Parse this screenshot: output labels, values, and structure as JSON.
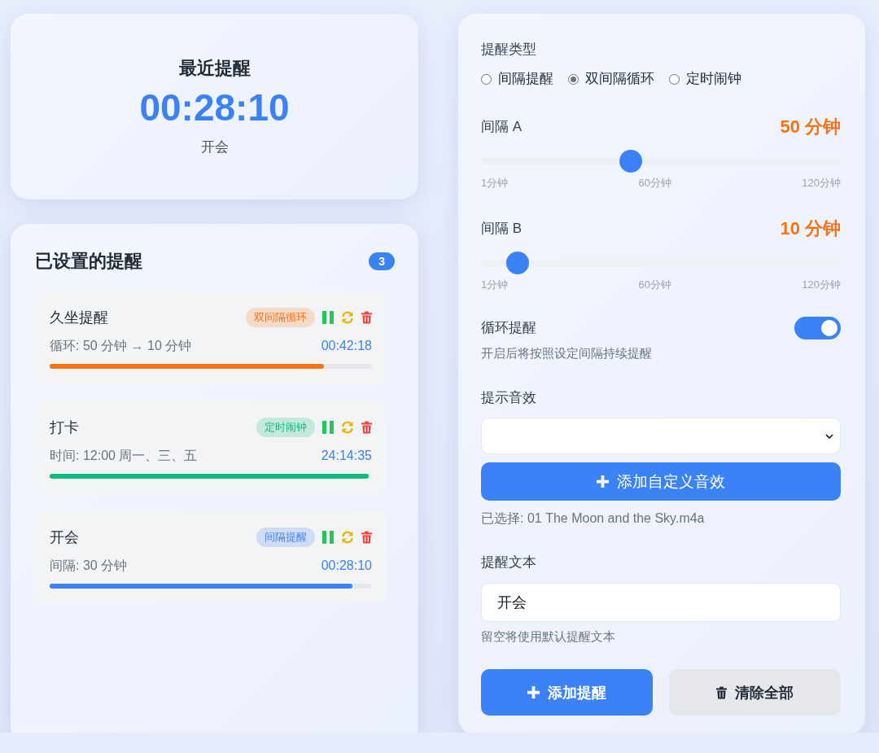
{
  "next_reminder": {
    "title": "最近提醒",
    "countdown": "00:28:10",
    "name": "开会"
  },
  "reminder_list": {
    "title": "已设置的提醒",
    "count": "3",
    "items": [
      {
        "name": "久坐提醒",
        "tag": "双间隔循环",
        "color": "#f97316",
        "detail": "循环: 50 分钟 → 10 分钟",
        "remaining": "00:42:18",
        "level": 0.85
      },
      {
        "name": "打卡",
        "tag": "定时闹钟",
        "color": "#10b981",
        "detail": "时间: 12:00 周一、三、五",
        "remaining": "24:14:35",
        "level": 0.99
      },
      {
        "name": "开会",
        "tag": "间隔提醒",
        "color": "#3b82f6",
        "detail": "间隔: 30 分钟",
        "remaining": "00:28:10",
        "level": 0.94
      }
    ]
  },
  "form": {
    "type_label": "提醒类型",
    "types": [
      {
        "label": "间隔提醒",
        "selected": false
      },
      {
        "label": "双间隔循环",
        "selected": true
      },
      {
        "label": "定时闹钟",
        "selected": false
      }
    ],
    "sliders": [
      {
        "label": "间隔 A",
        "reading": "50 分钟",
        "level": 0.41,
        "ticks": [
          "1分钟",
          "60分钟",
          "120分钟"
        ]
      },
      {
        "label": "间隔 B",
        "reading": "10 分钟",
        "level": 0.076,
        "ticks": [
          "1分钟",
          "60分钟",
          "120分钟"
        ]
      }
    ],
    "loop": {
      "label": "循环提醒",
      "hint": "开启后将按照设定间隔持续提醒",
      "on": true
    },
    "sound": {
      "label": "提示音效",
      "add_button": "添加自定义音效",
      "selected_file": "已选择: 01 The Moon and the Sky.m4a"
    },
    "text": {
      "label": "提醒文本",
      "value": "开会",
      "hint": "留空将使用默认提醒文本"
    },
    "buttons": [
      {
        "label": "添加提醒",
        "kind": "primary"
      },
      {
        "label": "清除全部",
        "kind": "secondary"
      }
    ]
  }
}
